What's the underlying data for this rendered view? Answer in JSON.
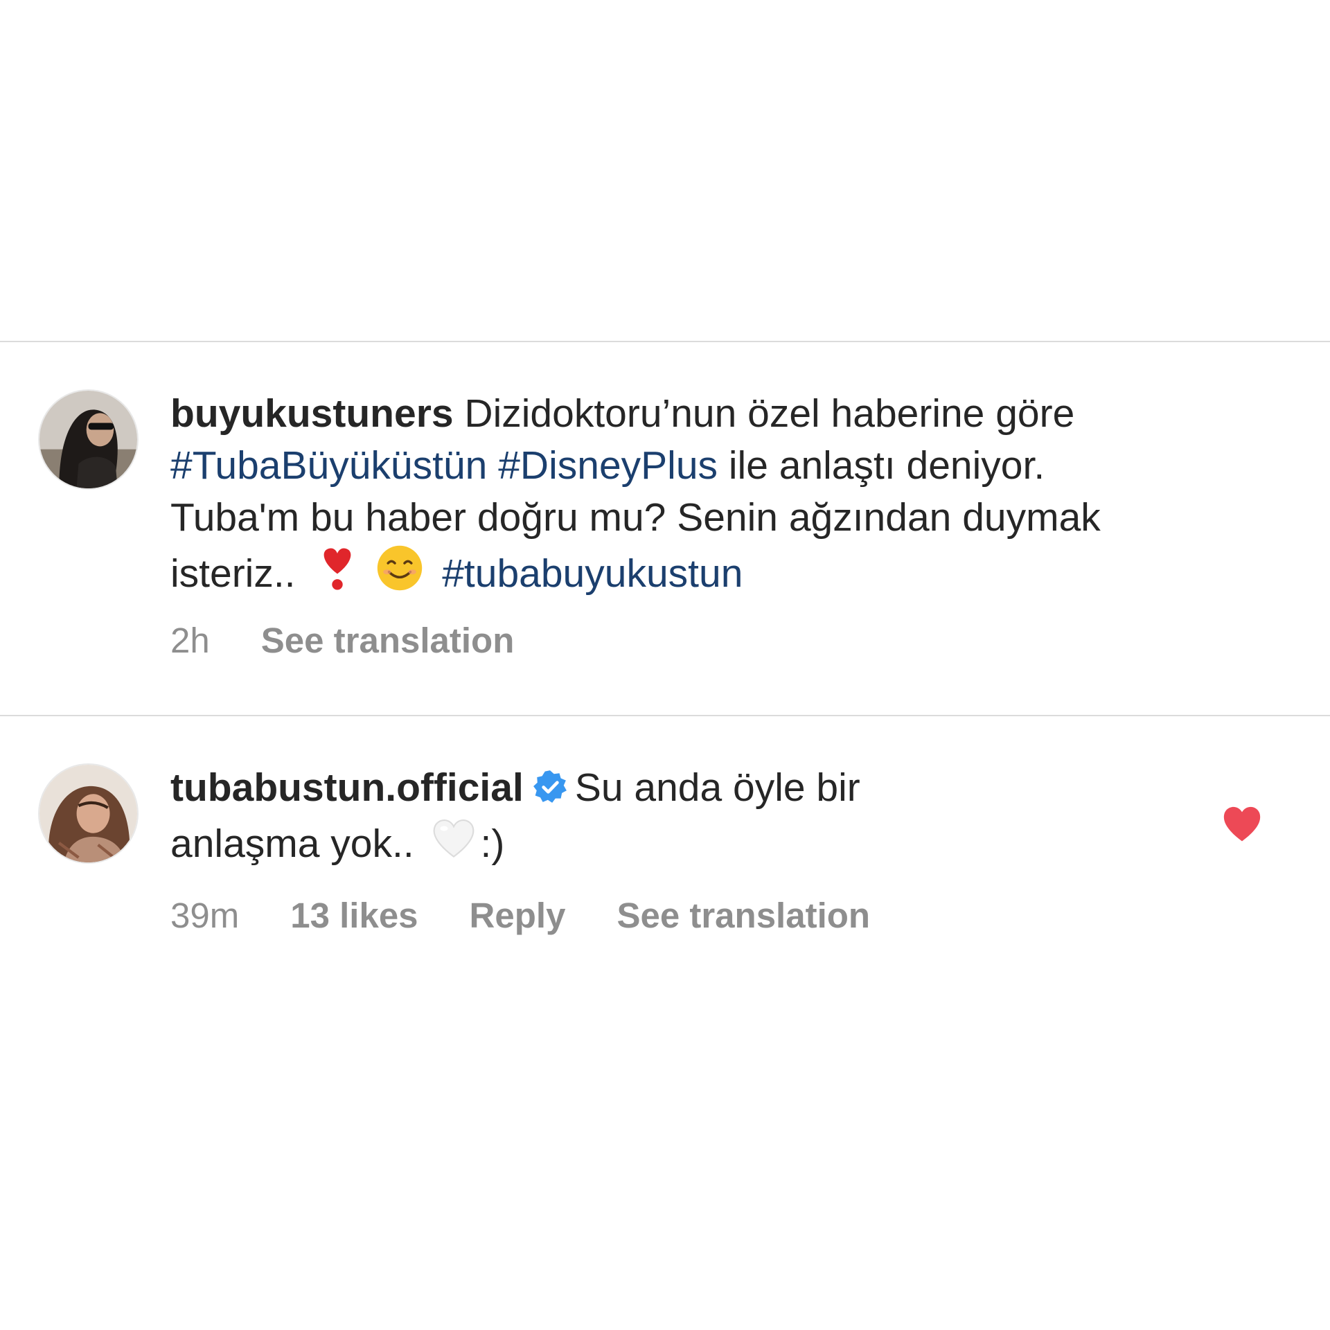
{
  "comments": [
    {
      "username": "buyukustuners",
      "text_1": "Dizidoktoru’nun özel haberine göre",
      "hashtag_1": "#TubaBüyüküstün",
      "hashtag_2": "#DisneyPlus",
      "text_2": "ile anlaştı deniyor.",
      "text_3": "Tuba'm bu haber doğru mu? Senin ağzından duymak",
      "text_4": "isteriz..",
      "emoji_1": "red-exclamation-heart-icon",
      "emoji_2": "smiling-face-icon",
      "hashtag_3": "#tubabuyukustun",
      "time": "2h",
      "see_translation": "See translation"
    },
    {
      "username": "tubabustun.official",
      "verified": true,
      "text_1": "Su anda öyle bir",
      "text_2": "anlaşma yok..",
      "emoji_1": "white-heart-icon",
      "text_3": ":)",
      "time": "39m",
      "likes": "13 likes",
      "reply": "Reply",
      "see_translation": "See translation",
      "liked": true
    }
  ],
  "colors": {
    "hashtag": "#1b3f6e",
    "meta": "#8e8e8e",
    "verified": "#3897f0",
    "like": "#ed4956",
    "divider": "#dbdbdb"
  }
}
